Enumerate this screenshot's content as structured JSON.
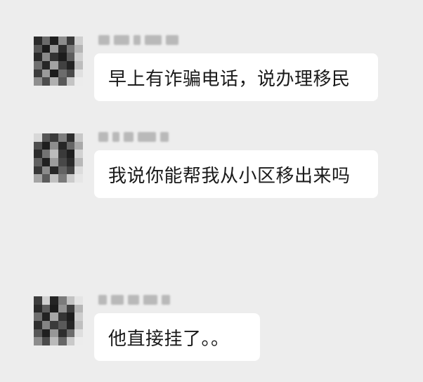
{
  "messages": [
    {
      "text": "早上有诈骗电话，说办理移民"
    },
    {
      "text": "我说你能帮我从小区移出来吗"
    },
    {
      "text": "他直接挂了。。"
    }
  ],
  "colors": {
    "background": "#ededed",
    "bubble": "#ffffff",
    "text": "#1a1a1a"
  },
  "icons": {
    "avatar": "pixelated-avatar-icon"
  }
}
